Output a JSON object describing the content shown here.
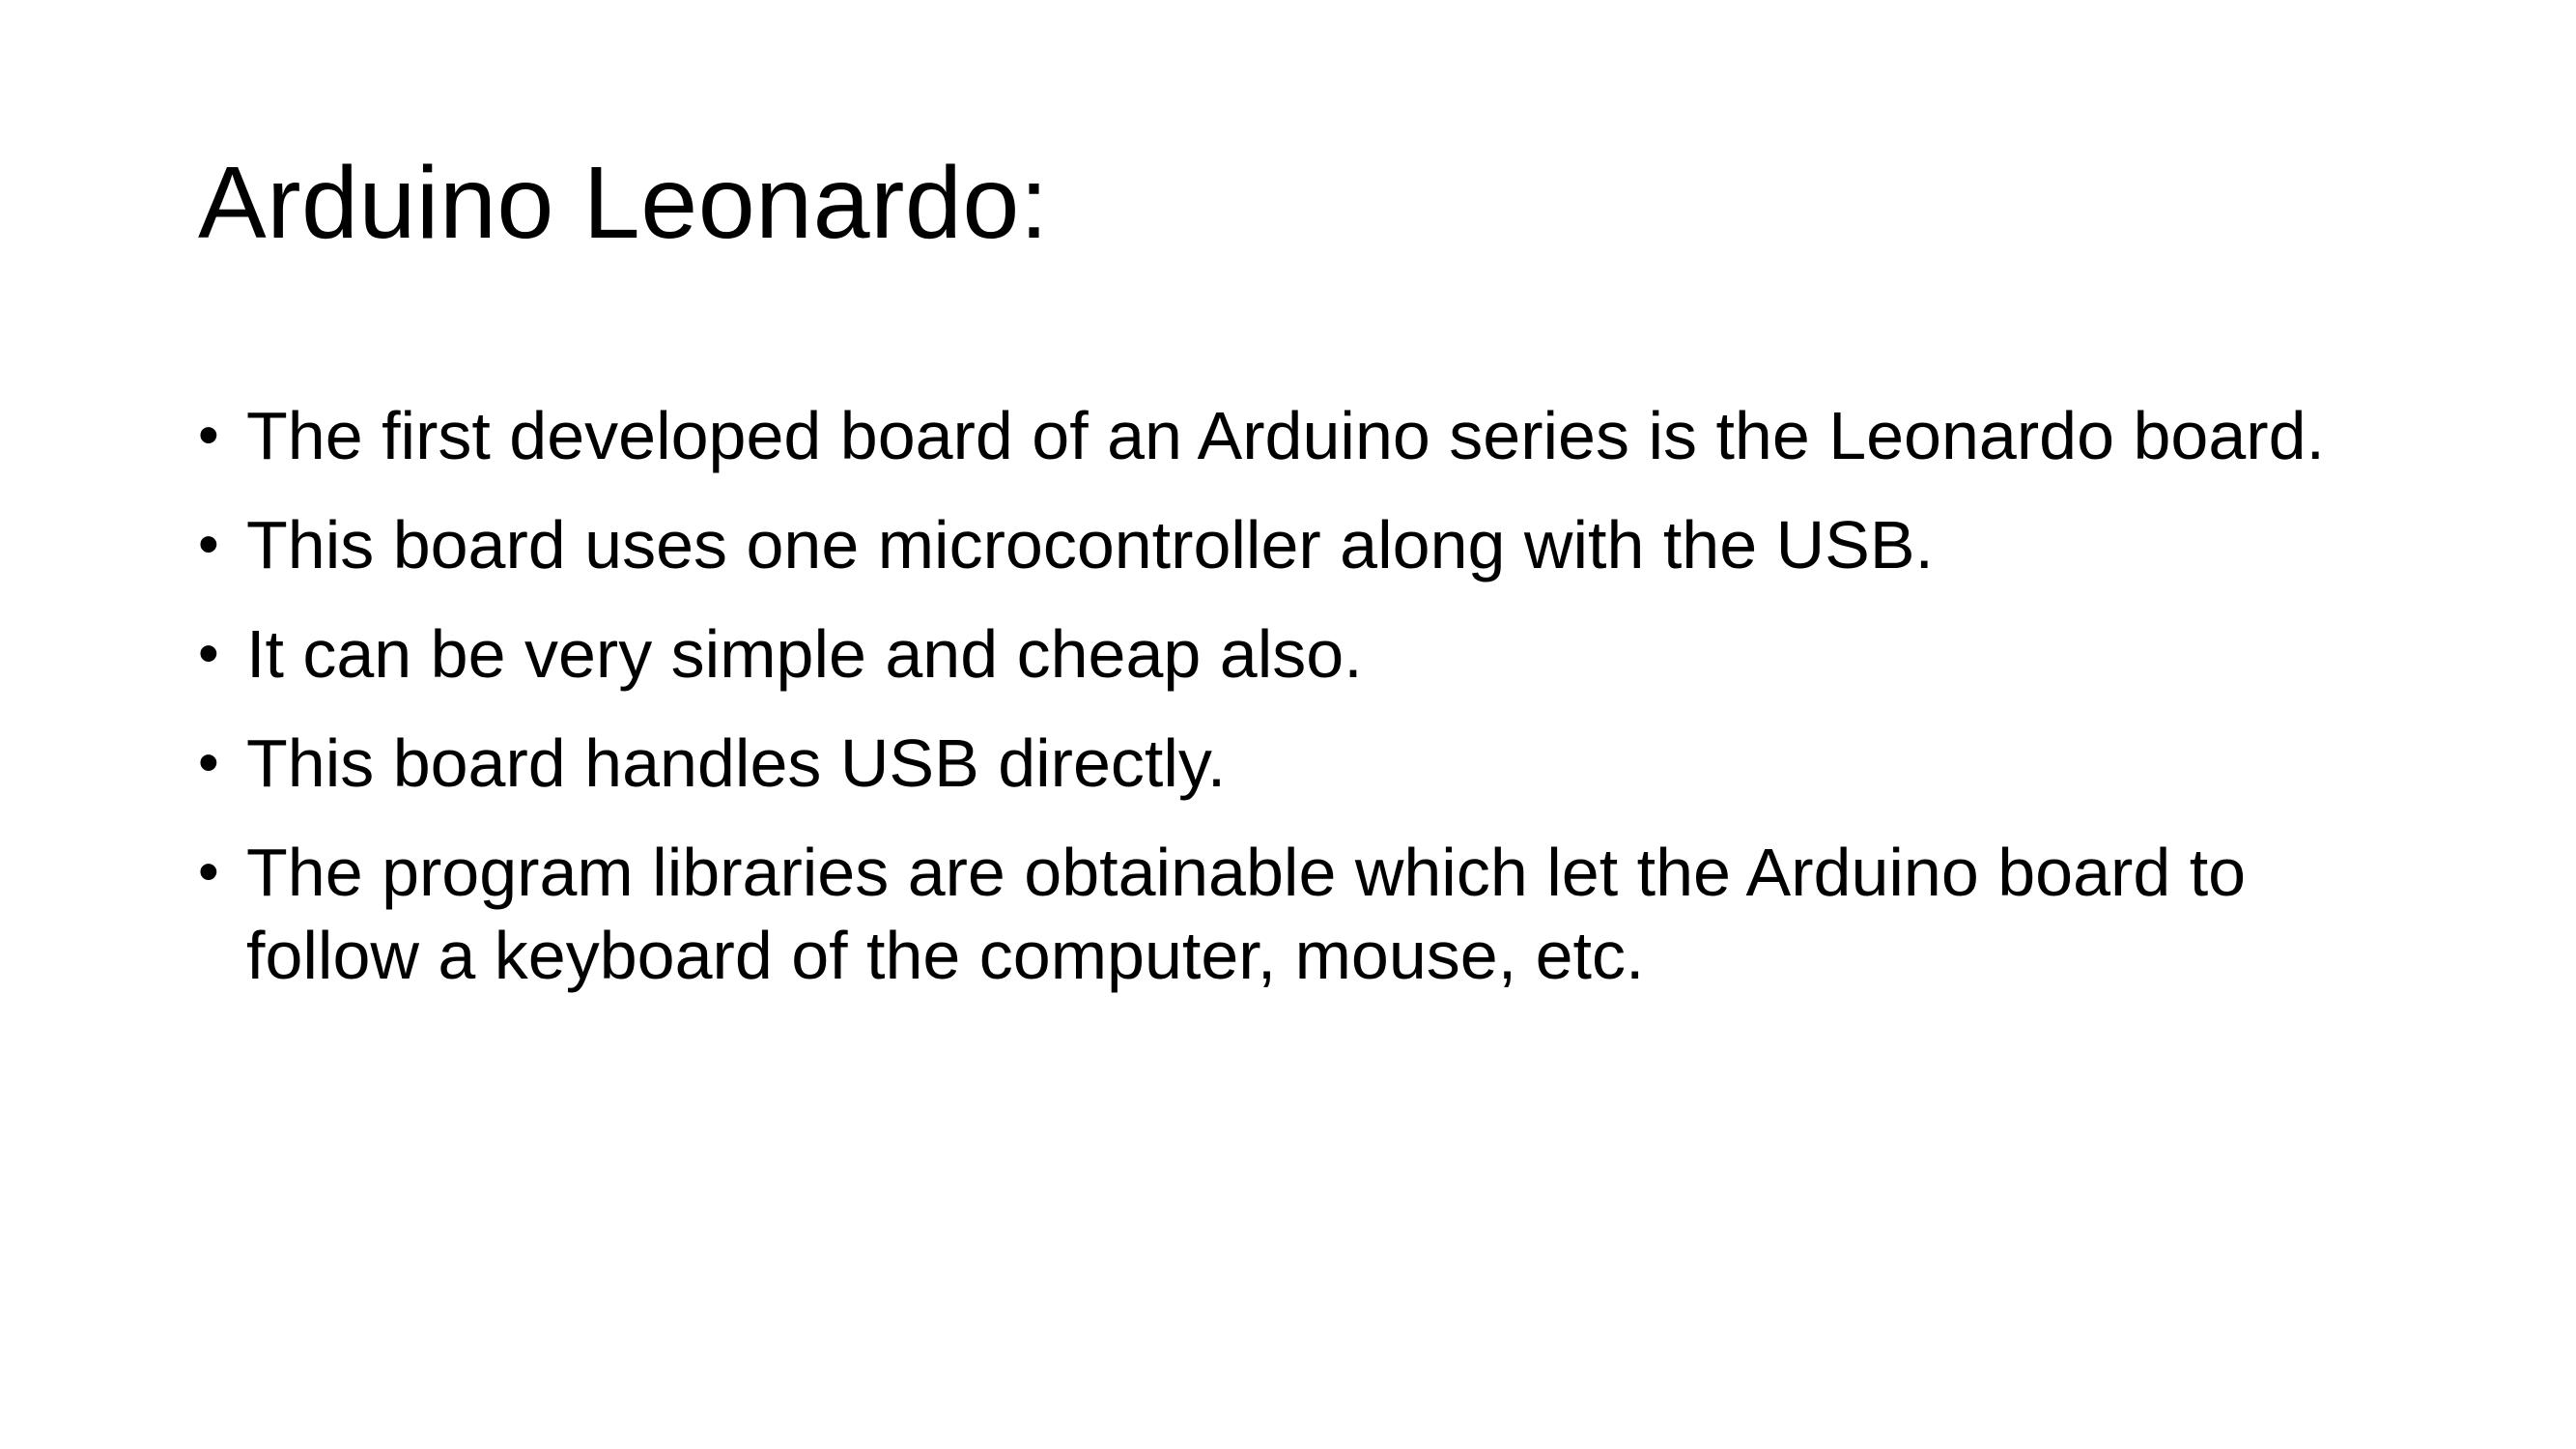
{
  "slide": {
    "title": "Arduino Leonardo:",
    "bullet_marker": "•",
    "bullets": [
      "The first developed board of an Arduino series is the Leonardo board.",
      "This board uses one microcontroller along with the USB.",
      "It can be very simple and cheap also.",
      "This board handles USB directly.",
      "The program libraries are obtainable which let the Arduino board to follow a keyboard of the computer, mouse, etc."
    ]
  },
  "colors": {
    "background": "#ffffff",
    "text": "#000000"
  }
}
